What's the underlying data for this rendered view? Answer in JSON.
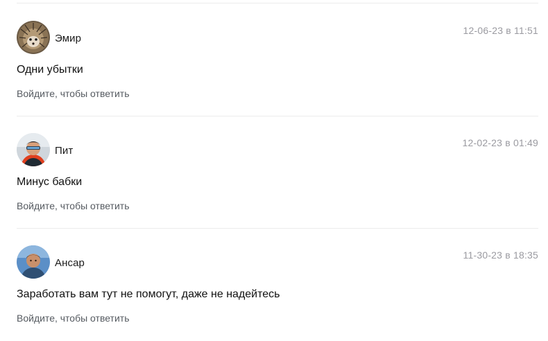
{
  "comments": [
    {
      "author": "Эмир",
      "date": "12-06-23 в 11:51",
      "text": "Одни убытки",
      "reply_label": "Войдите, чтобы ответить"
    },
    {
      "author": "Пит",
      "date": "12-02-23 в 01:49",
      "text": "Минус бабки",
      "reply_label": "Войдите, чтобы ответить"
    },
    {
      "author": "Ансар",
      "date": "11-30-23 в 18:35",
      "text": "Заработать вам тут не помогут, даже не надейтесь",
      "reply_label": "Войдите, чтобы ответить"
    }
  ]
}
